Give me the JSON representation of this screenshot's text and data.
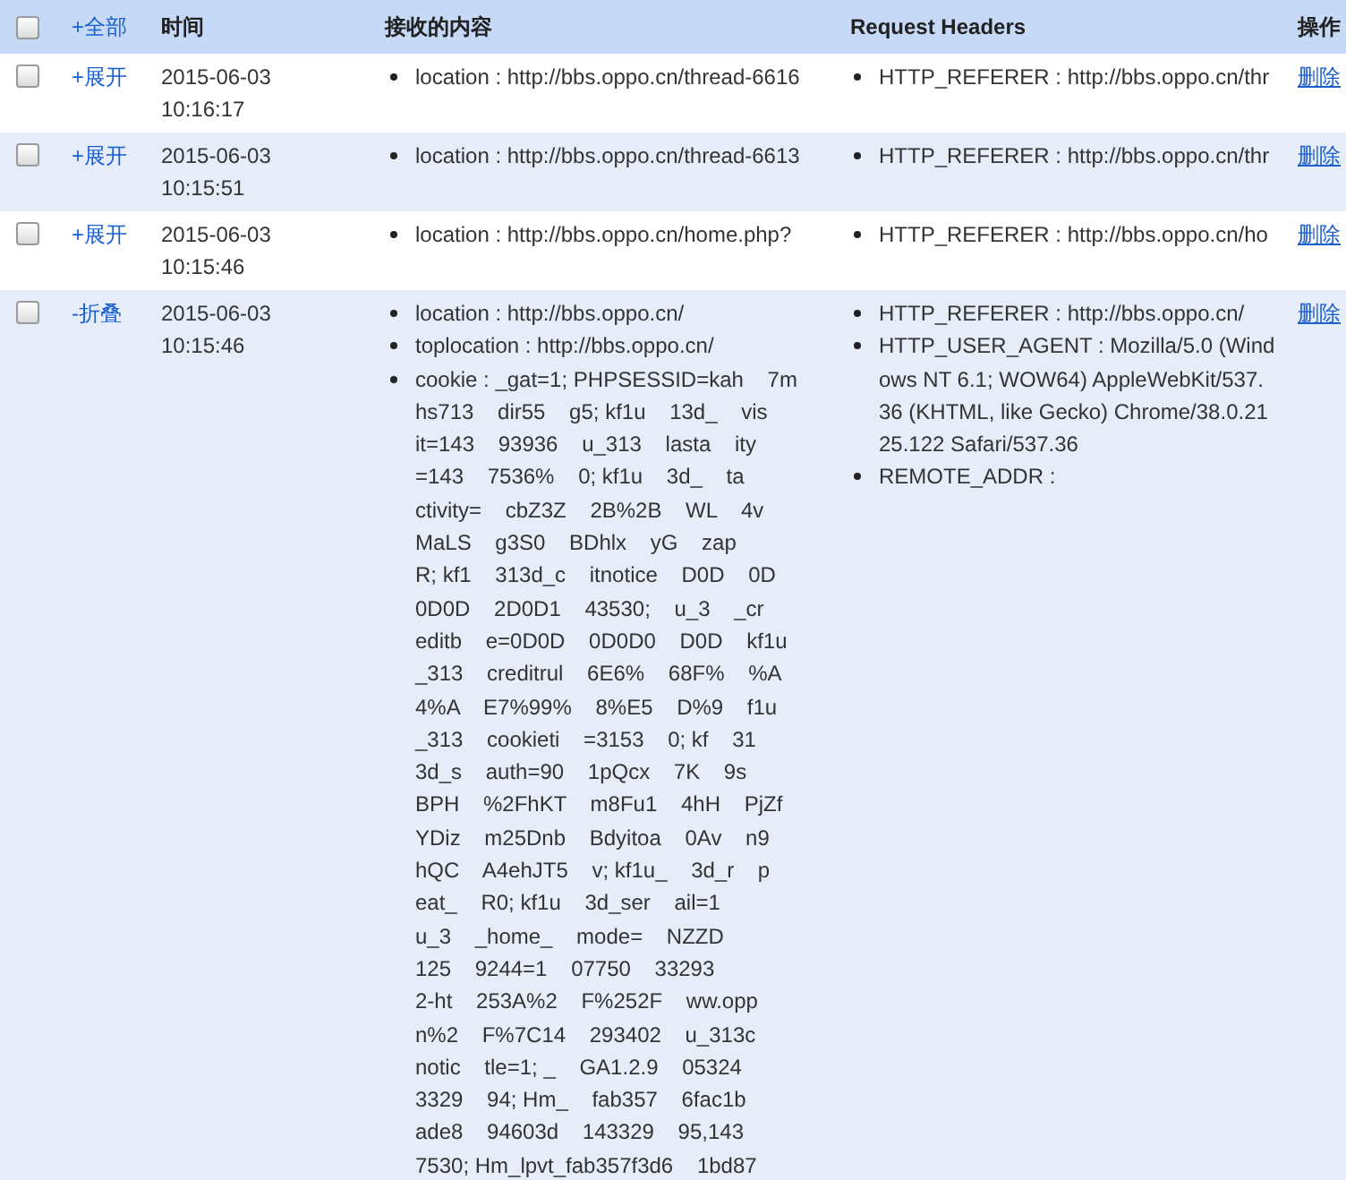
{
  "header": {
    "checked": false,
    "toggle": "+全部",
    "columns": [
      "时间",
      "接收的内容",
      "Request Headers",
      "操作"
    ]
  },
  "rows": [
    {
      "checked": false,
      "toggle": "+展开",
      "date": "2015-06-03",
      "time": "10:16:17",
      "content": [
        [
          "location : http://bbs.oppo.cn/thread-6616"
        ]
      ],
      "headers": [
        [
          "HTTP_REFERER : http://bbs.oppo.cn/thr"
        ]
      ],
      "action": "删除"
    },
    {
      "checked": false,
      "toggle": "+展开",
      "date": "2015-06-03",
      "time": "10:15:51",
      "content": [
        [
          "location : http://bbs.oppo.cn/thread-6613"
        ]
      ],
      "headers": [
        [
          "HTTP_REFERER : http://bbs.oppo.cn/thr"
        ]
      ],
      "action": "删除"
    },
    {
      "checked": false,
      "toggle": "+展开",
      "date": "2015-06-03",
      "time": "10:15:46",
      "content": [
        [
          "location : http://bbs.oppo.cn/home.php?"
        ]
      ],
      "headers": [
        [
          "HTTP_REFERER : http://bbs.oppo.cn/ho"
        ]
      ],
      "action": "删除"
    },
    {
      "checked": false,
      "toggle": "-折叠",
      "date": "2015-06-03",
      "time": "10:15:46",
      "content": [
        [
          "location : http://bbs.oppo.cn/"
        ],
        [
          "toplocation : http://bbs.oppo.cn/"
        ],
        [
          "cookie : _gat=1; PHPSESSID=kah    7m",
          "hs713    dir55    g5; kf1u    13d_    vis",
          "it=143    93936    u_313    lasta    ity",
          "=143    7536%    0; kf1u    3d_    ta",
          "ctivity=    cbZ3Z    2B%2B    WL    4v",
          "MaLS    g3S0    BDhlx    yG    zap",
          "R; kf1    313d_c    itnotice    D0D    0D",
          "0D0D    2D0D1    43530;    u_3    _cr",
          "editb    e=0D0D    0D0D0    D0D    kf1u",
          "_313    creditrul    6E6%    68F%    %A",
          "4%A    E7%99%    8%E5    D%9    f1u",
          "_313    cookieti    =3153    0; kf    31",
          "3d_s    auth=90    1pQcx    7K    9s",
          "BPH    %2FhKT    m8Fu1    4hH    PjZf",
          "YDiz    m25Dnb    Bdyitoa    0Av    n9",
          "hQC    A4ehJT5    v; kf1u_    3d_r    p",
          "eat_    R0; kf1u    3d_ser    ail=1",
          "u_3    _home_    mode=    NZZD",
          "125    9244=1    07750    33293",
          "2-ht    253A%2    F%252F    ww.opp",
          "n%2    F%7C14    293402    u_313c",
          "notic    tle=1; _    GA1.2.9    05324",
          "3329    94; Hm_    fab357    6fac1b",
          "ade8    94603d    143329    95,143",
          "7530; Hm_lpvt_fab357f3d6    1bd87"
        ]
      ],
      "headers": [
        [
          "HTTP_REFERER : http://bbs.oppo.cn/"
        ],
        [
          "HTTP_USER_AGENT : Mozilla/5.0 (Wind",
          "ows NT 6.1; WOW64) AppleWebKit/537.",
          "36 (KHTML, like Gecko) Chrome/38.0.21",
          "25.122 Safari/537.36"
        ],
        [
          "REMOTE_ADDR :"
        ]
      ],
      "action": "删除"
    }
  ]
}
